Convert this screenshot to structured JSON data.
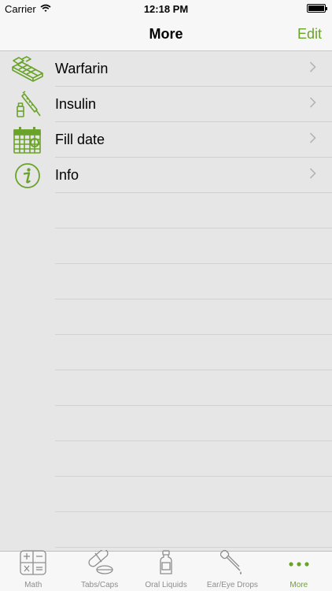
{
  "status_bar": {
    "carrier": "Carrier",
    "time": "12:18 PM"
  },
  "nav": {
    "title": "More",
    "edit_label": "Edit"
  },
  "list": {
    "items": [
      {
        "label": "Warfarin",
        "icon": "pill-organizer-icon"
      },
      {
        "label": "Insulin",
        "icon": "syringe-vial-icon"
      },
      {
        "label": "Fill date",
        "icon": "calendar-icon"
      },
      {
        "label": "Info",
        "icon": "info-icon"
      }
    ]
  },
  "tab_bar": {
    "tabs": [
      {
        "label": "Math",
        "icon": "calculator-icon",
        "active": false
      },
      {
        "label": "Tabs/Caps",
        "icon": "pills-icon",
        "active": false
      },
      {
        "label": "Oral Liquids",
        "icon": "bottle-icon",
        "active": false
      },
      {
        "label": "Ear/Eye Drops",
        "icon": "dropper-icon",
        "active": false
      },
      {
        "label": "More",
        "icon": "more-dots-icon",
        "active": true
      }
    ]
  },
  "colors": {
    "accent": "#6aa329",
    "background": "#e6e6e6",
    "bar_background": "#f7f7f7",
    "inactive": "#8e8e8e"
  }
}
